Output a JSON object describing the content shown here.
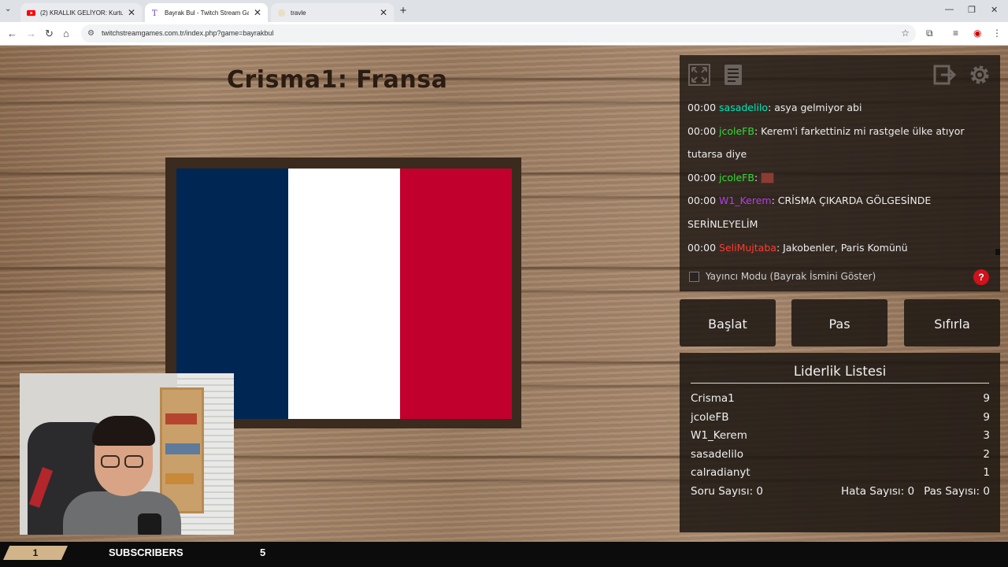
{
  "browser": {
    "tabs": [
      {
        "title": "(2) KRALLIK GELİYOR: Kurtuluş S",
        "icon": "youtube-icon",
        "active": false
      },
      {
        "title": "Bayrak Bul - Twitch Stream Gam",
        "icon": "twitch-stream-games-icon",
        "active": true
      },
      {
        "title": "travle",
        "icon": "globe-icon",
        "active": false
      }
    ],
    "url": "twitchstreamgames.com.tr/index.php?game=bayrakbul"
  },
  "game": {
    "title": "Crisma1: Fransa",
    "flag_colors": [
      "#002654",
      "#ffffff",
      "#c1002e"
    ]
  },
  "chat": {
    "messages": [
      {
        "time": "00:00",
        "user": "sasadelilo",
        "color": "#00e6b8",
        "text": ": asya gelmiyor abi"
      },
      {
        "time": "00:00",
        "user": "jcoleFB",
        "color": "#36d936",
        "text": ": Kerem'i farkettiniz mi rastgele ülke atıyor tutarsa diye"
      },
      {
        "time": "00:00",
        "user": "jcoleFB",
        "color": "#36d936",
        "text": ": ",
        "emote": true
      },
      {
        "time": "00:00",
        "user": "W1_Kerem",
        "color": "#b53ce6",
        "text": ": CRİSMA ÇIKARDA GÖLGESİNDE SERİNLEYELİM"
      },
      {
        "time": "00:00",
        "user": "SeliMujtaba",
        "color": "#ff3b2f",
        "text": ": Jakobenler, Paris Komünü"
      }
    ],
    "streamer_mode_label": "Yayıncı Modu (Bayrak İsmini Göster)",
    "help_label": "?"
  },
  "controls": {
    "start_label": "Başlat",
    "pass_label": "Pas",
    "reset_label": "Sıfırla"
  },
  "leaderboard": {
    "title": "Liderlik Listesi",
    "rows": [
      {
        "name": "Crisma1",
        "score": "9"
      },
      {
        "name": "jcoleFB",
        "score": "9"
      },
      {
        "name": "W1_Kerem",
        "score": "3"
      },
      {
        "name": "sasadelilo",
        "score": "2"
      },
      {
        "name": "calradianyt",
        "score": "1"
      }
    ],
    "question_count_label": "Soru Sayısı: 0",
    "error_count_label": "Hata Sayısı: 0",
    "pass_count_label": "Pas Sayısı: 0"
  },
  "overlay": {
    "badge": "1",
    "subscribers_label": "SUBSCRIBERS",
    "subscribers_count": "5"
  }
}
